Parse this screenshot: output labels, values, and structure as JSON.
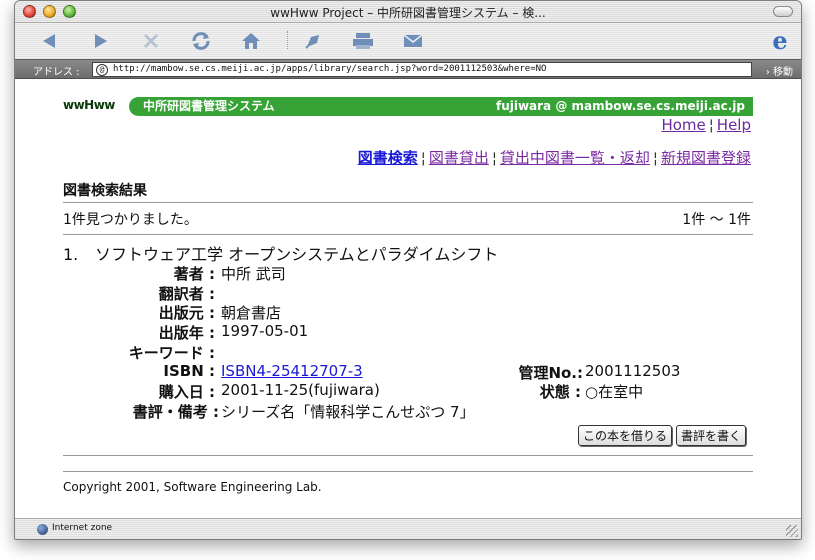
{
  "window": {
    "title": "wwHww Project – 中所研図書管理システム – 検..."
  },
  "toolbar": {
    "back_icon": "back-arrow-icon",
    "forward_icon": "forward-arrow-icon",
    "stop_icon": "stop-icon",
    "refresh_icon": "refresh-icon",
    "home_icon": "home-icon",
    "autofill_icon": "autofill-icon",
    "print_icon": "print-icon",
    "mail_icon": "mail-icon"
  },
  "address": {
    "label": "アドレス :",
    "url": "http://mambow.se.cs.meiji.ac.jp/apps/library/search.jsp?word=2001112503&where=NO",
    "go_label": "移動"
  },
  "banner": {
    "logo": "wwHww",
    "title": "中所研図書管理システム",
    "user": "fujiwara @ mambow.se.cs.meiji.ac.jp",
    "color": "#37a337"
  },
  "top_links": {
    "home": "Home",
    "separator": "¦",
    "help": "Help"
  },
  "nav": {
    "search": "図書検索",
    "lend": "図書貸出",
    "list_return": "貸出中図書一覧・返却",
    "register": "新規図書登録",
    "separator": "¦"
  },
  "results": {
    "heading": "図書検索結果",
    "found": "1件見つかりました。",
    "range": "1件 〜 1件"
  },
  "book": {
    "number": "1.",
    "title": "ソフトウェア工学 オープンシステムとパラダイムシフト",
    "author_label": "著者 :",
    "author": "中所 武司",
    "translator_label": "翻訳者 :",
    "translator": "",
    "publisher_label": "出版元 :",
    "publisher": "朝倉書店",
    "year_label": "出版年 :",
    "year": "1997-05-01",
    "keyword_label": "キーワード :",
    "keyword": "",
    "isbn_label": "ISBN :",
    "isbn": "ISBN4-25412707-3",
    "purchase_label": "購入日 :",
    "purchase": "2001-11-25(fujiwara)",
    "review_label": "書評・備考 :",
    "review": "シリーズ名「情報科学こんせぷつ 7」",
    "mgmt_label": "管理No.:",
    "mgmt": "2001112503",
    "status_label": "状態 :",
    "status": "○在室中"
  },
  "actions": {
    "borrow": "この本を借りる",
    "write_review": "書評を書く"
  },
  "footer": {
    "copyright": "Copyright 2001, Software Engineering Lab."
  },
  "status_bar": {
    "text": "Internet zone"
  }
}
